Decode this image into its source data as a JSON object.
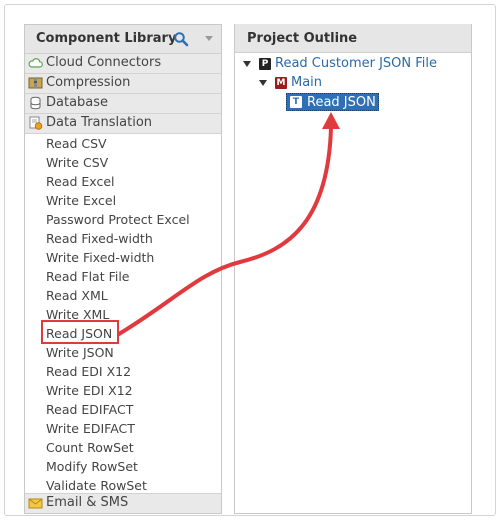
{
  "library": {
    "title": "Component Library",
    "categories": [
      {
        "label": "Cloud Connectors",
        "icon": "cloud-icon"
      },
      {
        "label": "Compression",
        "icon": "compression-icon"
      },
      {
        "label": "Database",
        "icon": "database-icon"
      },
      {
        "label": "Data Translation",
        "icon": "data-translation-icon"
      }
    ],
    "items": [
      "Read CSV",
      "Write CSV",
      "Read Excel",
      "Write Excel",
      "Password Protect Excel",
      "Read Fixed-width",
      "Write Fixed-width",
      "Read Flat File",
      "Read XML",
      "Write XML",
      "Read JSON",
      "Write JSON",
      "Read EDI X12",
      "Write EDI X12",
      "Read EDIFACT",
      "Write EDIFACT",
      "Count RowSet",
      "Modify RowSet",
      "Validate RowSet"
    ],
    "bottom_category": {
      "label": "Email & SMS",
      "icon": "email-icon"
    }
  },
  "outline": {
    "title": "Project Outline",
    "project": {
      "badge": "P",
      "label": "Read Customer JSON File"
    },
    "module": {
      "badge": "M",
      "label": "Main"
    },
    "task": {
      "badge": "T",
      "label": "Read JSON"
    }
  },
  "colors": {
    "accent": "#2f6fb5",
    "highlight": "#e0393e",
    "link": "#2a6aa6"
  }
}
